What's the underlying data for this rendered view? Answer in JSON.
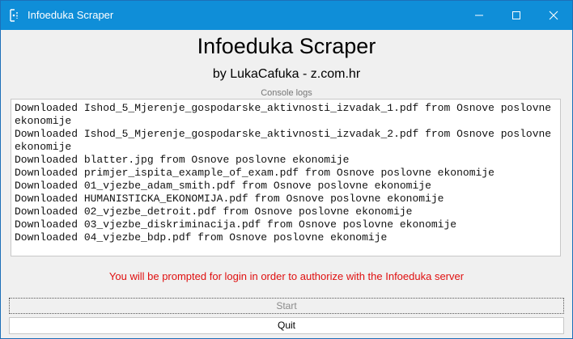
{
  "window": {
    "title": "Infoeduka Scraper",
    "icon": "python-feather-icon",
    "controls": [
      "minimize-icon",
      "maximize-icon",
      "close-icon"
    ],
    "titlebar_color": "#0f8ed8"
  },
  "header": {
    "title": "Infoeduka Scraper",
    "subtitle": "by LukaCafuka - z.com.hr"
  },
  "console": {
    "label": "Console logs",
    "lines": [
      "Downloaded Ishod_5_Mjerenje_gospodarske_aktivnosti_izvadak_1.pdf from Osnove poslovne ekonomije",
      "Downloaded Ishod_5_Mjerenje_gospodarske_aktivnosti_izvadak_2.pdf from Osnove poslovne ekonomije",
      "Downloaded blatter.jpg from Osnove poslovne ekonomije",
      "Downloaded primjer_ispita_example_of_exam.pdf from Osnove poslovne ekonomije",
      "Downloaded 01_vjezbe_adam_smith.pdf from Osnove poslovne ekonomije",
      "Downloaded HUMANISTICKA_EKONOMIJA.pdf from Osnove poslovne ekonomije",
      "Downloaded 02_vjezbe_detroit.pdf from Osnove poslovne ekonomije",
      "Downloaded 03_vjezbe_diskriminacija.pdf from Osnove poslovne ekonomije",
      "Downloaded 04_vjezbe_bdp.pdf from Osnove poslovne ekonomije"
    ]
  },
  "notice": {
    "text": "You will be prompted for login in order to authorize with the Infoeduka server",
    "color": "#e01010"
  },
  "buttons": {
    "start_label": "Start",
    "quit_label": "Quit"
  }
}
